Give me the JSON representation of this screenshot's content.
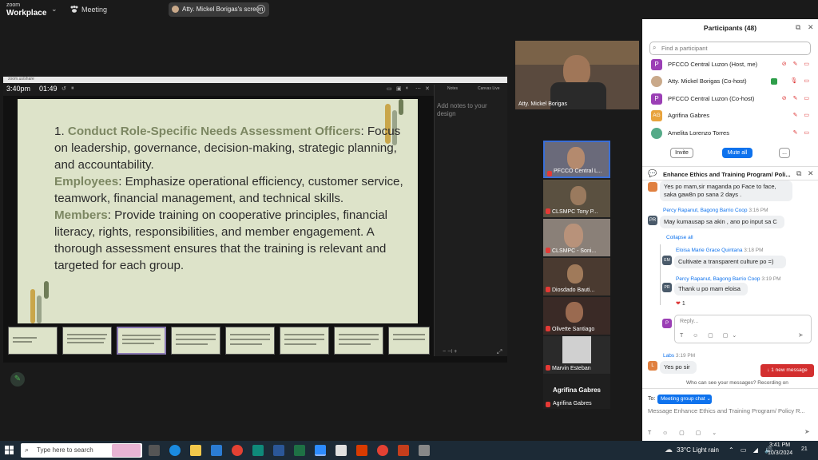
{
  "app": {
    "logo_top": "zoom",
    "logo_bottom": "Workplace",
    "meeting_label": "Meeting"
  },
  "share": {
    "pill_text": "Atty. Mickel Borigas's screen",
    "strip_label": "zoom.us/share",
    "time": "3:40pm",
    "timer": "01:49",
    "notes_tab": "Notes",
    "canvas_tab": "Canvas Live",
    "notes_placeholder": "Add notes to your design"
  },
  "slide": {
    "n1": "1. ",
    "h1": "Conduct Role-Specific Needs Assessment Officers",
    "t1": ": Focus on leadership, governance, decision-making, strategic planning, and accountability.",
    "h2": "Employees",
    "t2": ": Emphasize operational efficiency, customer service, teamwork, financial management, and technical skills.",
    "h3": "Members",
    "t3": ": Provide training on cooperative principles, financial literacy, rights, responsibilities, and member engagement. A thorough assessment ensures that the training is relevant and targeted for each group."
  },
  "videos": {
    "main": "Atty. Mickel Borigas",
    "tiles": [
      "PFCCO Central L...",
      "CLSMPC Tony P...",
      "CLSMPC - Soni...",
      "Diosdado Bauti...",
      "Olivette Santiago",
      "Marvin Esteban"
    ],
    "big_name": "Agrifina Gabres",
    "small_name": "Agrifina Gabres"
  },
  "participants": {
    "title": "Participants (48)",
    "search_placeholder": "Find a participant",
    "items": [
      {
        "name": "PFCCO Central Luzon (Host, me)",
        "initial": "P",
        "color": "#9b3fb5"
      },
      {
        "name": "Atty. Mickel Borigas (Co-host)",
        "initial": "",
        "color": "#c9a98a"
      },
      {
        "name": "PFCCO Central Luzon (Co-host)",
        "initial": "P",
        "color": "#9b3fb5"
      },
      {
        "name": "Agrifina Gabres",
        "initial": "AG",
        "color": "#e8a33c"
      },
      {
        "name": "Amelita Lorenzo Torres",
        "initial": "",
        "color": "#5a8"
      }
    ],
    "invite": "Invite",
    "mute_all": "Mute all",
    "more": "..."
  },
  "chat": {
    "title": "Enhance Ethics and Training Program/ Poli...",
    "msg0": "Yes po mam,sir maganda po Face to face, saka gaw8n po sana 2 days .",
    "msg1_sender": "Percy Rapanut, Bagong Barrio Coop",
    "msg1_time": "3:16 PM",
    "msg1": "May kumausap sa akin , ano po input sa C",
    "collapse": "Collapse all",
    "r1_sender": "Eloisa Marie Grace Quintana",
    "r1_time": "3:18 PM",
    "r1": "Cultivate a transparent culture po =)",
    "r2_sender": "Percy Rapanut, Bagong Barrio Coop",
    "r2_time": "3:19 PM",
    "r2": "Thank u po mam eloisa",
    "reaction_count": "1",
    "reply_placeholder": "Reply...",
    "msg2_sender": "Labs",
    "msg2_time": "3:19 PM",
    "msg2": "Yes po sir",
    "new_message": "1 new message",
    "recording": "Who can see your messages? Recording on",
    "to_label": "To:",
    "to_value": "Meeting group chat",
    "input_placeholder": "Message Enhance Ethics and Training Program/ Policy R..."
  },
  "taskbar": {
    "search": "Type here to search",
    "weather": "33°C  Light rain",
    "time": "3:41 PM",
    "date": "10/3/2024",
    "notif": "21"
  }
}
